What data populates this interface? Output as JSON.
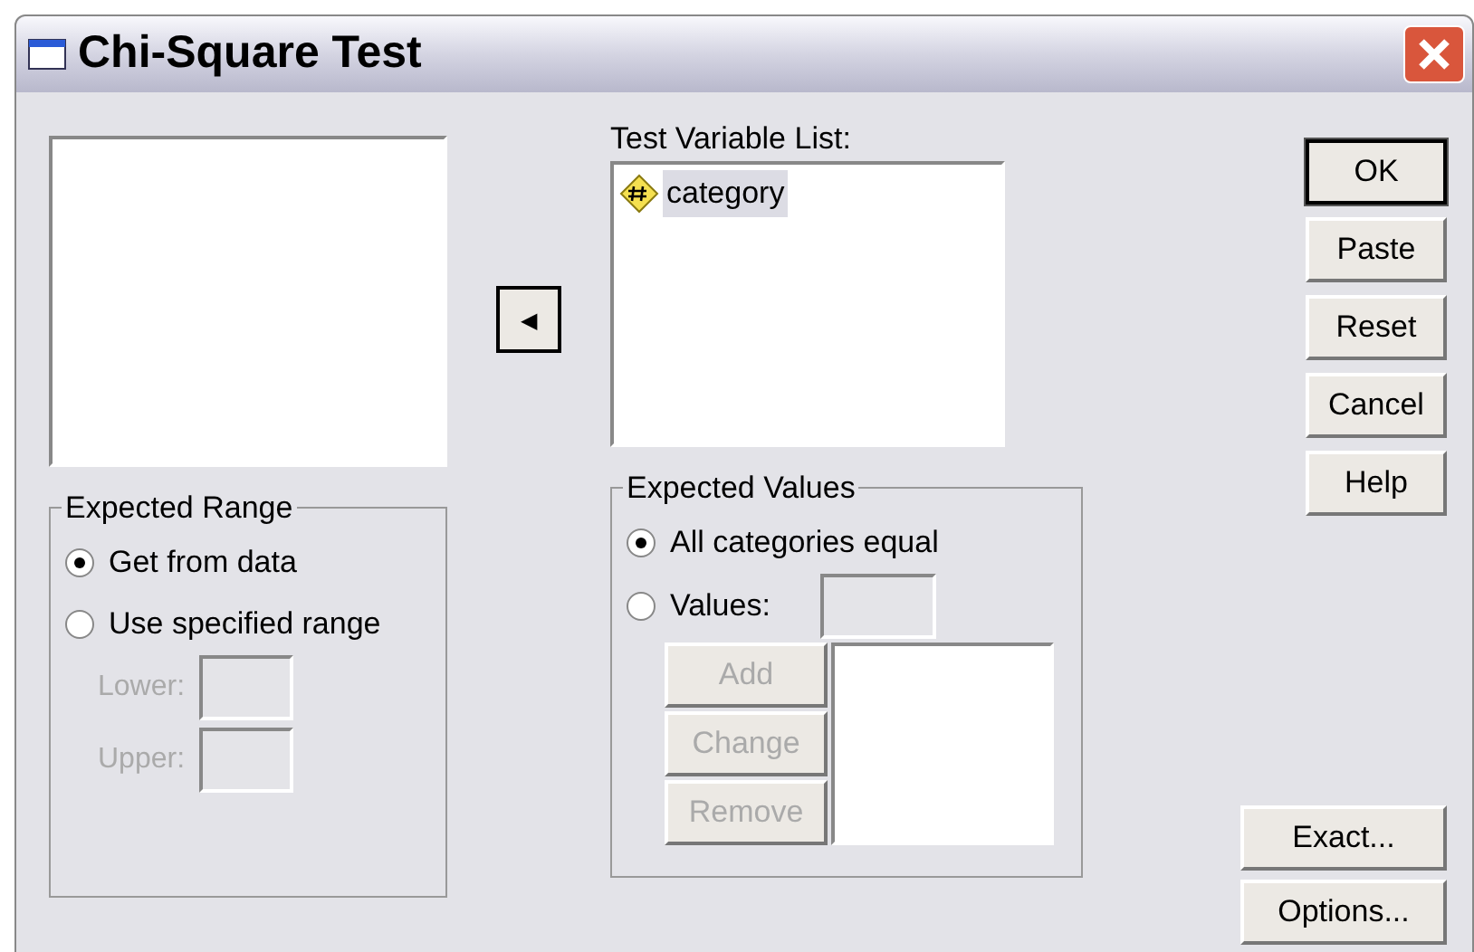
{
  "window": {
    "title": "Chi-Square Test"
  },
  "move_button": {
    "symbol": "◀"
  },
  "test_variable_list": {
    "label": "Test Variable List:",
    "items": [
      {
        "name": "category",
        "selected": true
      }
    ]
  },
  "expected_range": {
    "title": "Expected Range",
    "options": [
      {
        "label": "Get from data",
        "selected": true
      },
      {
        "label": "Use specified range",
        "selected": false
      }
    ],
    "fields": [
      {
        "label": "Lower:",
        "disabled": true
      },
      {
        "label": "Upper:",
        "disabled": true
      }
    ]
  },
  "expected_values": {
    "title": "Expected Values",
    "options": [
      {
        "label": "All categories equal",
        "selected": true
      },
      {
        "label": "Values:",
        "selected": false
      }
    ],
    "value_field": {
      "disabled": true
    },
    "buttons": [
      {
        "label": "Add",
        "disabled": true
      },
      {
        "label": "Change",
        "disabled": true
      },
      {
        "label": "Remove",
        "disabled": true
      }
    ]
  },
  "buttons": [
    {
      "label": "OK",
      "default": true
    },
    {
      "label": "Paste",
      "default": false
    },
    {
      "label": "Reset",
      "default": false
    },
    {
      "label": "Cancel",
      "default": false
    },
    {
      "label": "Help",
      "default": false
    }
  ],
  "bottom_buttons": [
    {
      "label": "Exact...",
      "default": false
    },
    {
      "label": "Options...",
      "default": false
    }
  ]
}
